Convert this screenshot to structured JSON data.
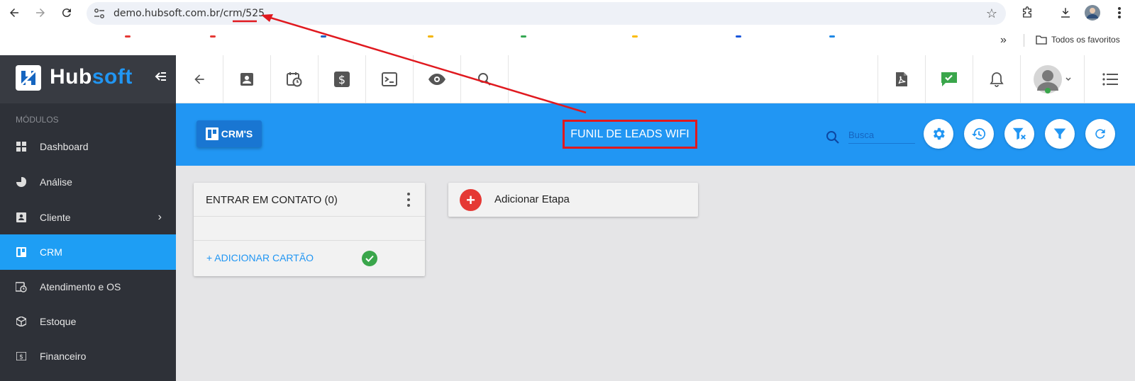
{
  "browser": {
    "url": "demo.hubsoft.com.br/crm/525",
    "bookmarks_all_label": "Todos os favoritos",
    "overflow_label": "»"
  },
  "sidebar": {
    "logo": {
      "part1": "Hub",
      "part2": "soft"
    },
    "modules_header": "MÓDULOS",
    "items": [
      {
        "label": "Dashboard",
        "icon": "dashboard-icon"
      },
      {
        "label": "Análise",
        "icon": "pie-chart-icon"
      },
      {
        "label": "Cliente",
        "icon": "contact-card-icon"
      },
      {
        "label": "CRM",
        "icon": "kanban-board-icon"
      },
      {
        "label": "Atendimento e OS",
        "icon": "calendar-clock-icon"
      },
      {
        "label": "Estoque",
        "icon": "box-icon"
      },
      {
        "label": "Financeiro",
        "icon": "money-icon"
      }
    ],
    "active_item": "CRM"
  },
  "toolbar": {
    "icons": [
      "back-arrow-icon",
      "contact-card-icon",
      "calendar-clock-icon",
      "dollar-icon",
      "terminal-icon",
      "eye-icon",
      "search-icon"
    ],
    "right_icons": [
      "pdf-icon",
      "chat-check-icon",
      "bell-icon",
      "avatar",
      "list-icon"
    ]
  },
  "header": {
    "crms_label": "CRM'S",
    "pipeline_title": "FUNIL DE LEADS WIFI",
    "search_placeholder": "Busca"
  },
  "board": {
    "columns": [
      {
        "title": "ENTRAR EM CONTATO (0)",
        "add_card_label": "+ ADICIONAR CARTÃO"
      }
    ],
    "add_stage_label": "Adicionar Etapa"
  },
  "colors": {
    "sidebar_bg": "#2e3138",
    "accent_blue": "#2196f3",
    "active_item": "#1e9ef4",
    "annotation_red": "#e0191f",
    "success_green": "#3aa64b"
  }
}
